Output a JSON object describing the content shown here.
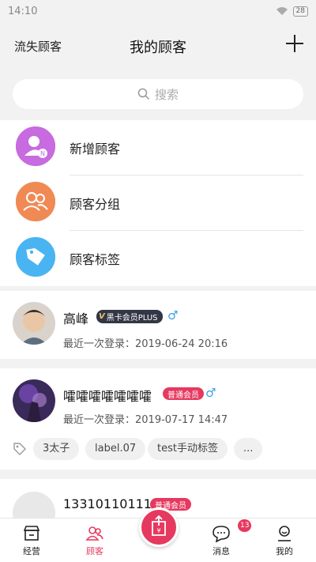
{
  "status": {
    "time": "14:10",
    "battery": "28"
  },
  "header": {
    "left_label": "流失顾客",
    "title": "我的顾客"
  },
  "search": {
    "placeholder": "搜索"
  },
  "entries": [
    {
      "label": "新增顾客",
      "icon": "user-add-icon",
      "color": "#c86ae0"
    },
    {
      "label": "顾客分组",
      "icon": "group-icon",
      "color": "#f08a55"
    },
    {
      "label": "顾客标签",
      "icon": "tag-icon",
      "color": "#4ab4f2"
    }
  ],
  "customers": [
    {
      "name": "高峰",
      "badge_v": "V",
      "badge": "黑卡会员PLUS",
      "gender": "♂",
      "last_login": "最近一次登录：2019-06-24 20:16"
    },
    {
      "name": "嚯嚯嚯嚯嚯嚯嚯",
      "badge": "普通会员",
      "gender": "♂",
      "last_login": "最近一次登录：2019-07-17 14:47",
      "tags": [
        "3太子",
        "label.07",
        "test手动标签",
        "..."
      ]
    },
    {
      "name": "13310110111",
      "badge": "普通会员"
    }
  ],
  "nav": {
    "items": [
      {
        "label": "经营",
        "icon": "store-icon"
      },
      {
        "label": "顾客",
        "icon": "customers-icon"
      },
      {
        "label": "消息",
        "icon": "message-icon",
        "badge": "13"
      },
      {
        "label": "我的",
        "icon": "profile-icon"
      }
    ],
    "active": "顾客",
    "fab_icon": "share-bag-icon"
  },
  "colors": {
    "accent": "#e6395f",
    "background": "#f2f2f2",
    "gender": "#3aa0e8"
  }
}
